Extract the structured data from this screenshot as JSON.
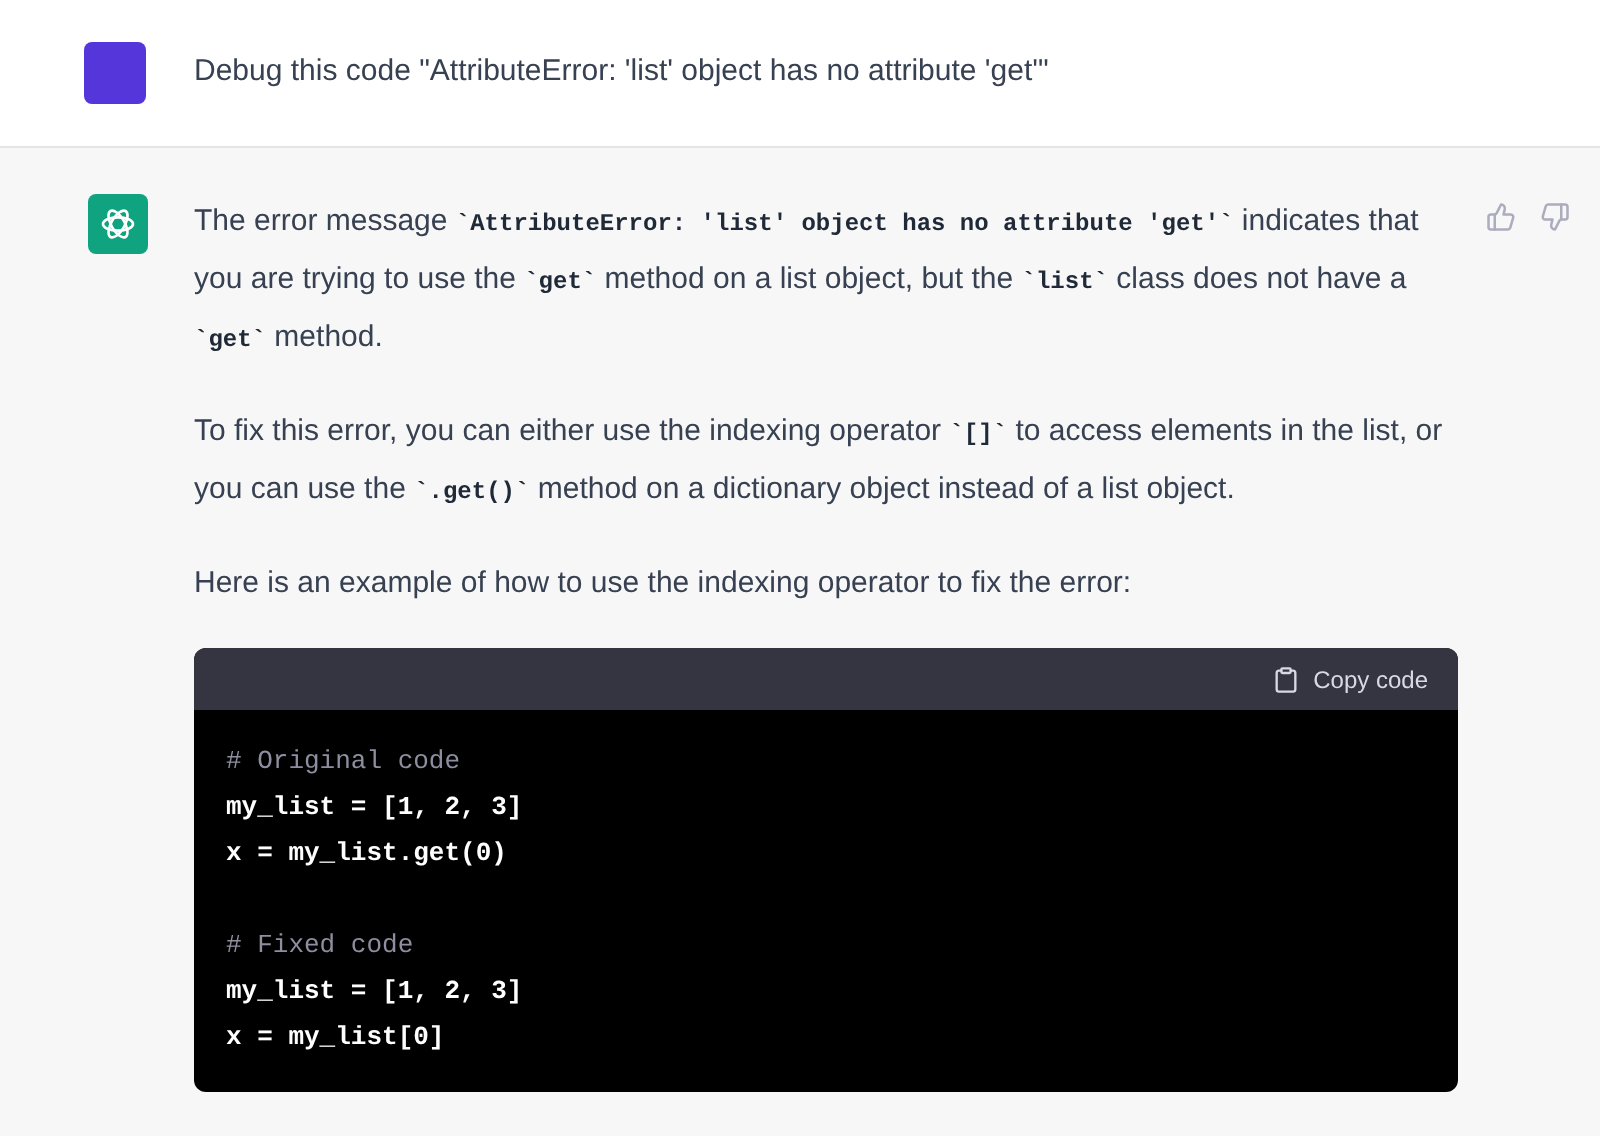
{
  "user_message": {
    "text": "Debug this code \"AttributeError: 'list' object has no attribute 'get'\""
  },
  "assistant_message": {
    "paragraphs": [
      [
        {
          "kind": "text",
          "text": "The error message "
        },
        {
          "kind": "code",
          "text": "`AttributeError: 'list' object has no attribute 'get'`"
        },
        {
          "kind": "text",
          "text": " indicates that you are trying to use the "
        },
        {
          "kind": "code",
          "text": "`get`"
        },
        {
          "kind": "text",
          "text": " method on a list object, but the "
        },
        {
          "kind": "code",
          "text": "`list`"
        },
        {
          "kind": "text",
          "text": " class does not have a "
        },
        {
          "kind": "code",
          "text": "`get`"
        },
        {
          "kind": "text",
          "text": " method."
        }
      ],
      [
        {
          "kind": "text",
          "text": "To fix this error, you can either use the indexing operator "
        },
        {
          "kind": "code",
          "text": "`[]`"
        },
        {
          "kind": "text",
          "text": " to access elements in the list, or you can use the "
        },
        {
          "kind": "code",
          "text": "`.get()`"
        },
        {
          "kind": "text",
          "text": " method on a dictionary object instead of a list object."
        }
      ],
      [
        {
          "kind": "text",
          "text": "Here is an example of how to use the indexing operator to fix the error:"
        }
      ]
    ],
    "code_block": {
      "copy_label": "Copy code",
      "lines": [
        {
          "kind": "comment",
          "text": "# Original code"
        },
        {
          "kind": "code",
          "text": "my_list = [1, 2, 3]"
        },
        {
          "kind": "code",
          "text": "x = my_list.get(0)"
        },
        {
          "kind": "blank"
        },
        {
          "kind": "comment",
          "text": "# Fixed code"
        },
        {
          "kind": "code",
          "text": "my_list = [1, 2, 3]"
        },
        {
          "kind": "code",
          "text": "x = my_list[0]"
        }
      ]
    }
  }
}
